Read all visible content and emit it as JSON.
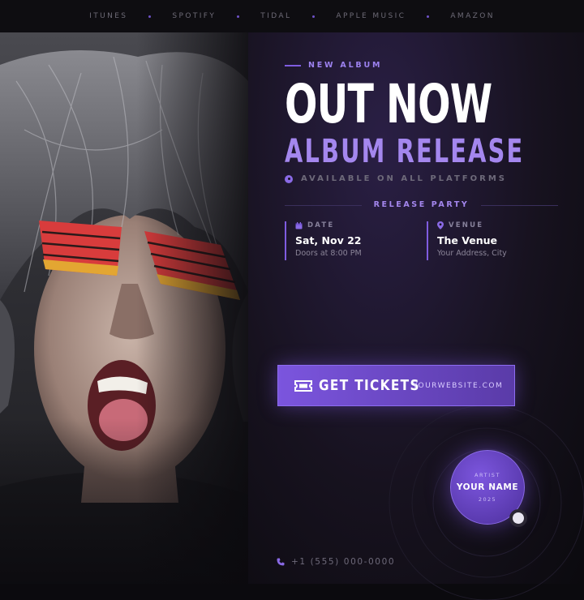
{
  "nav": {
    "links": [
      "ITUNES",
      "SPOTIFY",
      "TIDAL",
      "APPLE MUSIC",
      "AMAZON"
    ]
  },
  "hero": {
    "eyebrow": "NEW ALBUM",
    "title": "OUT NOW",
    "subtitle": "ALBUM RELEASE",
    "platforms": "AVAILABLE ON ALL PLATFORMS"
  },
  "party": {
    "heading": "RELEASE PARTY",
    "date": {
      "label": "DATE",
      "main": "Sat, Nov 22",
      "sub": "Doors at 8:00 PM",
      "icon": "calendar-icon"
    },
    "venue": {
      "label": "VENUE",
      "main": "The Venue",
      "sub": "Your Address, City",
      "icon": "map-pin-icon"
    }
  },
  "cta": {
    "label": "GET TICKETS",
    "website": "YOURWEBSITE.COM",
    "icon": "ticket-icon"
  },
  "badge": {
    "top": "ARTIST",
    "name": "YOUR NAME",
    "year": "2025"
  },
  "contact": {
    "phone": "+1 (555) 000-0000",
    "icon": "phone-icon"
  },
  "colors": {
    "accent": "#7f5ce0",
    "accent_light": "#a487ee",
    "background": "#0b0a0e"
  }
}
